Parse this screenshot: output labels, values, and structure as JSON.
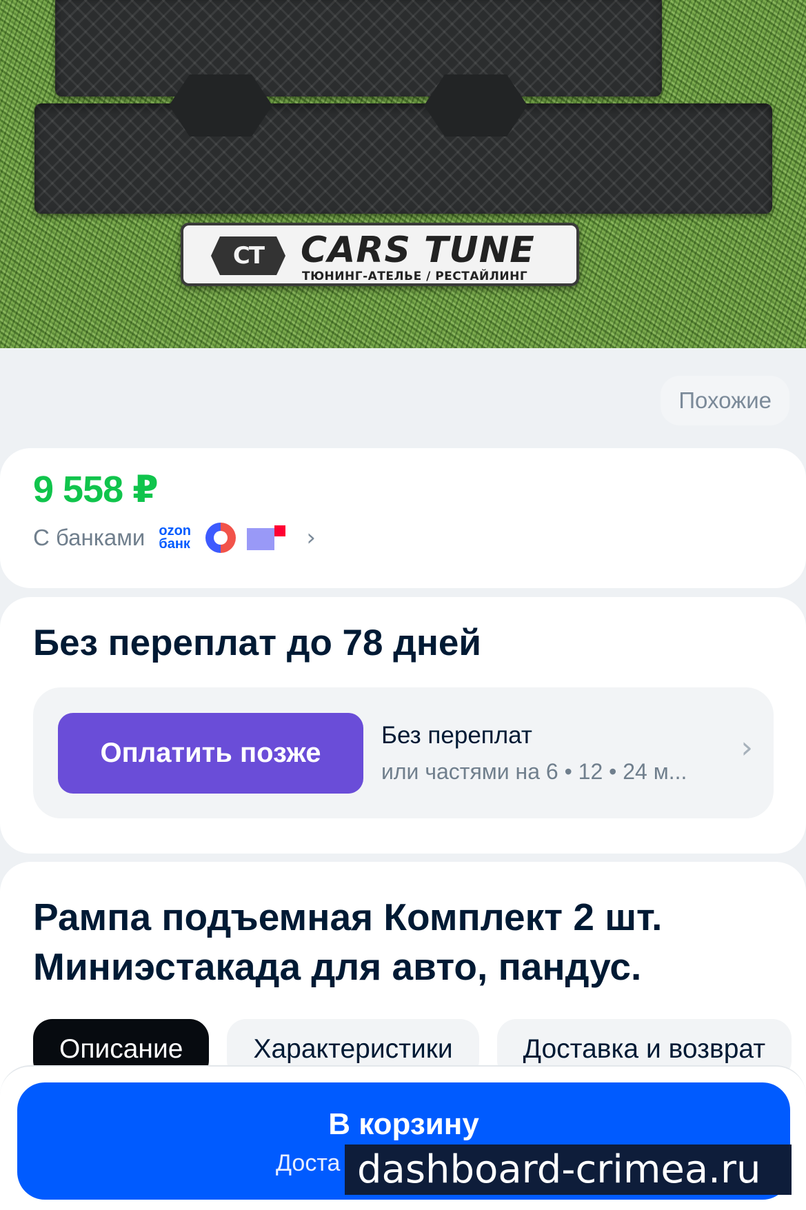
{
  "hero": {
    "brand": "CARS TUNE",
    "logo_text": "CT",
    "tagline": "ТЮНИНГ-АТЕЛЬЕ / РЕСТАЙЛИНГ"
  },
  "similar": {
    "label": "Похожие"
  },
  "price": {
    "value": "9 558 ₽",
    "with_banks_label": "С банками",
    "ozon_bank_text": "ozon банк",
    "color": "#10c44c"
  },
  "credit": {
    "title": "Без переплат до 78 дней",
    "pay_later_label": "Оплатить позже",
    "line1": "Без переплат",
    "line2": "или частями на 6 • 12 • 24 м...",
    "accent": "#6a4dd8"
  },
  "product": {
    "title": "Рампа подъемная Комплект 2 шт. Миниэстакада для авто, пандус.",
    "tabs": [
      {
        "label": "Описание",
        "active": true
      },
      {
        "label": "Характеристики",
        "active": false
      },
      {
        "label": "Доставка и возврат",
        "active": false
      }
    ]
  },
  "cart": {
    "label": "В корзину",
    "sub_label": "Доста",
    "color": "#005bff"
  },
  "watermark": {
    "text": "dashboard-crimea.ru"
  }
}
